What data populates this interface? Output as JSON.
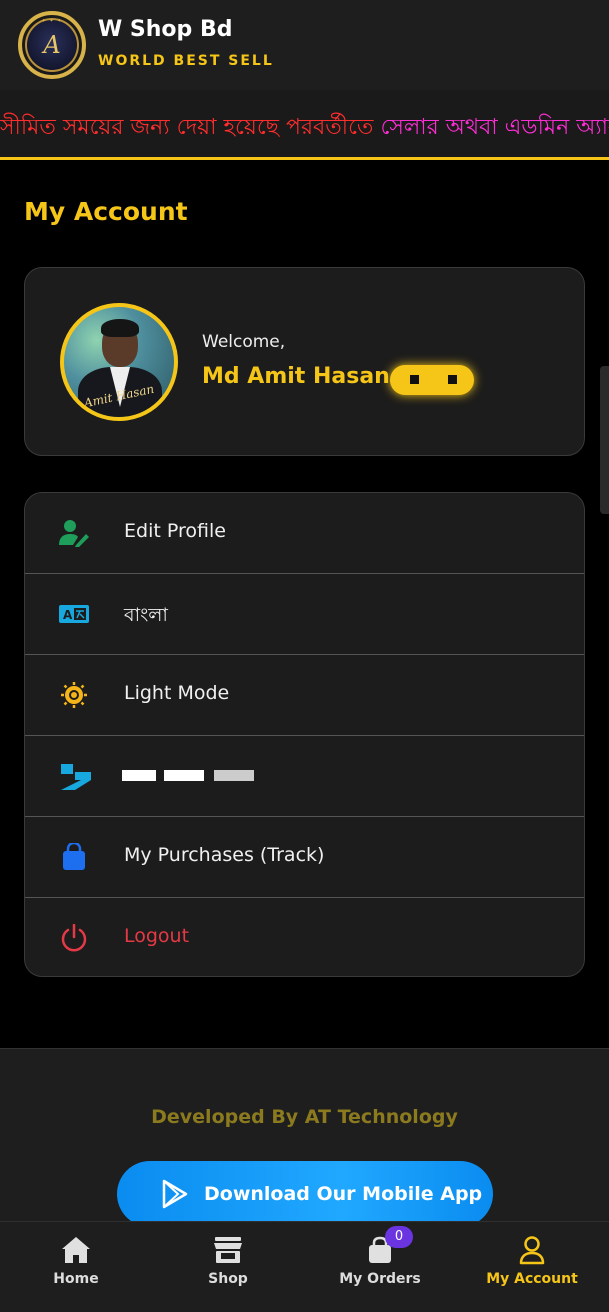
{
  "header": {
    "brand_name": "W Shop Bd",
    "tagline": "WORLD BEST SELL",
    "logo_letter": "A"
  },
  "marquee": {
    "text_red": "সীমিত সময়ের জন্য দেয়া হয়েছে পরবর্তীতে ",
    "text_pink": "সেলার অথবা এডমিন অ্যাকাউ"
  },
  "page": {
    "title": "My Account"
  },
  "profile": {
    "welcome": "Welcome,",
    "name": "Md Amit Hasan",
    "avatar_caption": "Amit Hasan"
  },
  "menu": {
    "items": [
      {
        "label": "Edit Profile",
        "icon": "user-edit-icon"
      },
      {
        "label": "বাংলা",
        "icon": "language-icon"
      },
      {
        "label": "Light Mode",
        "icon": "sun-icon"
      },
      {
        "label": "",
        "icon": "dashboard-icon"
      },
      {
        "label": "My Purchases (Track)",
        "icon": "shopping-bag-icon"
      },
      {
        "label": "Logout",
        "icon": "power-icon"
      }
    ]
  },
  "footer": {
    "developer_credit": "Developed By AT Technology",
    "app_button_label": "Download Our Mobile App"
  },
  "bottom_nav": {
    "items": [
      {
        "label": "Home",
        "icon": "home-icon"
      },
      {
        "label": "Shop",
        "icon": "store-icon"
      },
      {
        "label": "My Orders",
        "icon": "cart-icon",
        "badge": "0"
      },
      {
        "label": "My Account",
        "icon": "user-icon",
        "active": true
      }
    ]
  },
  "colors": {
    "accent": "#f5c518",
    "logout": "#e53946",
    "app_button": "#0a8cf0",
    "badge": "#6a35e0"
  }
}
